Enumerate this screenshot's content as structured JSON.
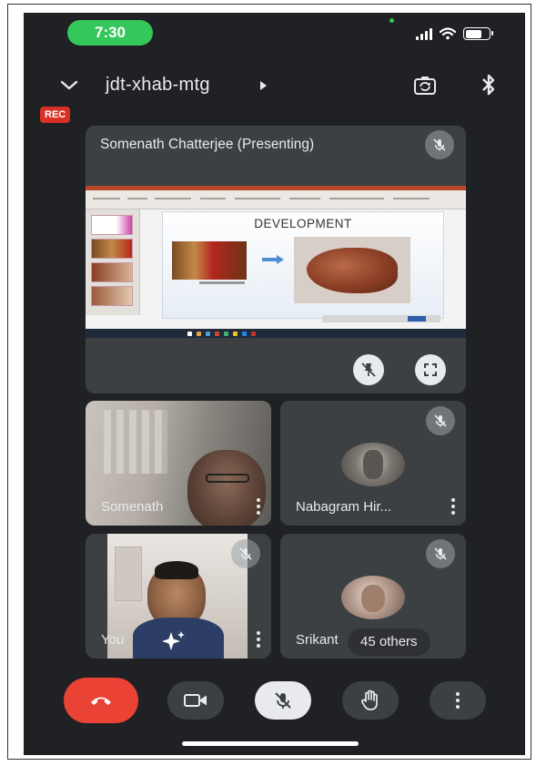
{
  "status_bar": {
    "time": "7:30"
  },
  "header": {
    "meeting_code": "jdt-xhab-mtg",
    "rec_label": "REC"
  },
  "presenting": {
    "name": "Somenath Chatterjee (Presenting)",
    "slide_title": "DEVELOPMENT"
  },
  "participants": [
    {
      "name": "Somenath"
    },
    {
      "name": "Nabagram Hir..."
    },
    {
      "name": "You"
    },
    {
      "name": "Srikant"
    }
  ],
  "others_label": "45 others",
  "colors": {
    "background": "#202124",
    "tile": "#3c4043",
    "end_call": "#ea4335",
    "status_green": "#34c759",
    "rec": "#d93025"
  },
  "icons": {
    "header": [
      "chevron-down-icon",
      "caret-right-icon",
      "camera-flip-icon",
      "bluetooth-icon"
    ],
    "controls": [
      "end-call-icon",
      "video-camera-icon",
      "mic-off-icon",
      "raise-hand-icon",
      "more-vert-icon"
    ]
  }
}
